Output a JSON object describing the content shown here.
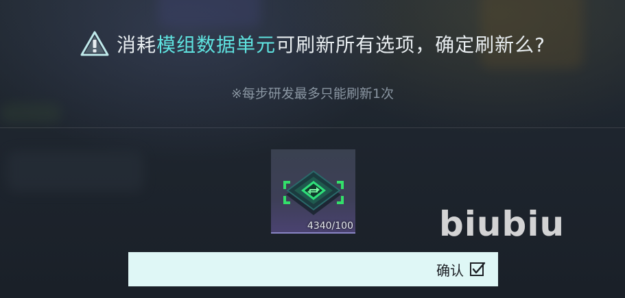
{
  "dialog": {
    "title_prefix": "消耗",
    "title_highlight": "模组数据单元",
    "title_suffix": "可刷新所有选项，确定刷新么?",
    "subtitle": "※每步研发最多只能刷新1次"
  },
  "item": {
    "icon": "refresh-chip-icon",
    "count": "4340/100"
  },
  "watermark": "biubiu",
  "confirm": {
    "label": "确认",
    "icon": "checkbox-icon"
  },
  "colors": {
    "highlight": "#5fe3e0",
    "button_bg": "#dff7f6",
    "chip_green": "#33e06a"
  }
}
